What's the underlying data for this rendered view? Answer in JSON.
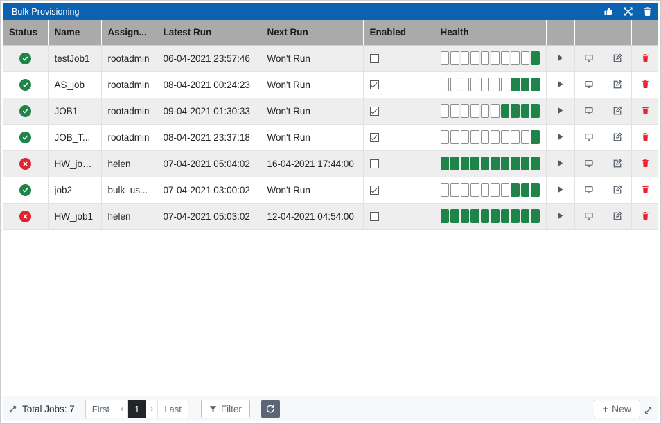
{
  "window": {
    "title": "Bulk Provisioning",
    "icons": [
      {
        "name": "thumbs-up-icon",
        "label": "thumbs-up"
      },
      {
        "name": "expand-icon",
        "label": "expand"
      },
      {
        "name": "trash-icon",
        "label": "delete"
      }
    ]
  },
  "table": {
    "columns": [
      {
        "key": "status",
        "label": "Status"
      },
      {
        "key": "name",
        "label": "Name"
      },
      {
        "key": "assigned",
        "label": "Assign..."
      },
      {
        "key": "latest",
        "label": "Latest Run"
      },
      {
        "key": "next",
        "label": "Next Run"
      },
      {
        "key": "enabled",
        "label": "Enabled"
      },
      {
        "key": "health",
        "label": "Health"
      },
      {
        "key": "run",
        "label": ""
      },
      {
        "key": "console",
        "label": ""
      },
      {
        "key": "edit",
        "label": ""
      },
      {
        "key": "delete",
        "label": ""
      }
    ],
    "health_segments": 10,
    "rows": [
      {
        "status": "ok",
        "name": "testJob1",
        "assigned": "rootadmin",
        "latest": "06-04-2021 23:57:46",
        "next": "Won't Run",
        "enabled": false,
        "health": 1
      },
      {
        "status": "ok",
        "name": "AS_job",
        "assigned": "rootadmin",
        "latest": "08-04-2021 00:24:23",
        "next": "Won't Run",
        "enabled": true,
        "health": 3
      },
      {
        "status": "ok",
        "name": "JOB1",
        "assigned": "rootadmin",
        "latest": "09-04-2021 01:30:33",
        "next": "Won't Run",
        "enabled": true,
        "health": 4
      },
      {
        "status": "ok",
        "name": "JOB_T...",
        "assigned": "rootadmin",
        "latest": "08-04-2021 23:37:18",
        "next": "Won't Run",
        "enabled": true,
        "health": 1
      },
      {
        "status": "error",
        "name": "HW_job...",
        "assigned": "helen",
        "latest": "07-04-2021 05:04:02",
        "next": "16-04-2021 17:44:00",
        "enabled": false,
        "health": 10
      },
      {
        "status": "ok",
        "name": "job2",
        "assigned": "bulk_us...",
        "latest": "07-04-2021 03:00:02",
        "next": "Won't Run",
        "enabled": true,
        "health": 3
      },
      {
        "status": "error",
        "name": "HW_job1",
        "assigned": "helen",
        "latest": "07-04-2021 05:03:02",
        "next": "12-04-2021 04:54:00",
        "enabled": false,
        "health": 10
      }
    ]
  },
  "footer": {
    "total_label": "Total Jobs: 7",
    "pager": {
      "first": "First",
      "prev": "‹",
      "current": "1",
      "next": "›",
      "last": "Last"
    },
    "filter_label": "Filter",
    "refresh_label": "Refresh",
    "new_plus": "+",
    "new_label": "New"
  },
  "colors": {
    "title_bar": "#0b62b0",
    "header_row": "#aaaaaa",
    "status_ok": "#1f8449",
    "status_error": "#e0232e",
    "health_on": "#1f8449",
    "delete_icon": "#e8232e",
    "refresh_button": "#5a6673",
    "pager_active": "#222426"
  }
}
